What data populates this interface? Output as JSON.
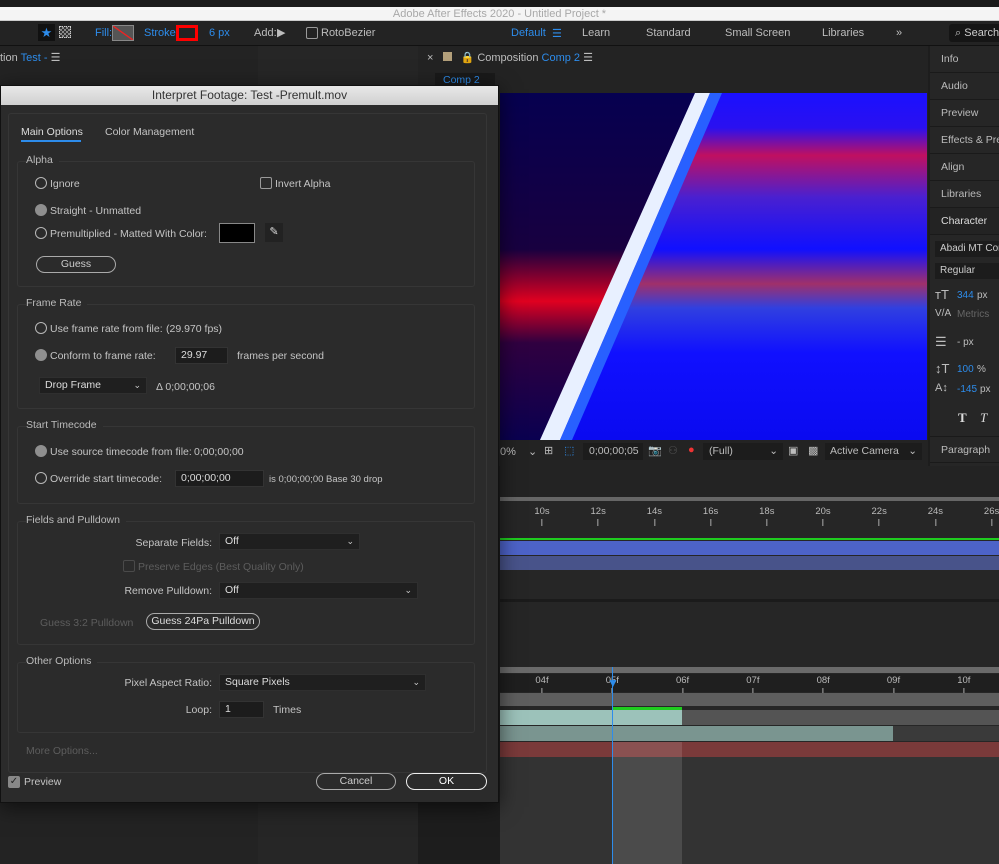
{
  "app": {
    "title": "Adobe After Effects 2020 - Untitled Project *"
  },
  "toolbar": {
    "fill_label": "Fill:",
    "stroke_label": "Stroke:",
    "stroke_width": "6 px",
    "add_label": "Add:",
    "rotobezier_label": "RotoBezier",
    "stroke_color": "#ff0000"
  },
  "workspaces": {
    "items": [
      "Default",
      "Learn",
      "Standard",
      "Small Screen",
      "Libraries"
    ],
    "active": "Default",
    "more": "»",
    "search_placeholder": "Search"
  },
  "left_panel": {
    "title_prefix": "tion",
    "title_name": "Test -"
  },
  "comp_panel": {
    "title_prefix": "Composition",
    "title_name": "Comp 2",
    "tab": "Comp 2"
  },
  "viewer_bar": {
    "zoom": "0%",
    "timecode": "0;00;00;05",
    "resolution": "(Full)",
    "camera": "Active Camera"
  },
  "right_panel": {
    "items": [
      "Info",
      "Audio",
      "Preview",
      "Effects & Presets",
      "Align",
      "Libraries"
    ],
    "character": "Character",
    "font": "Abadi MT Con",
    "style": "Regular",
    "font_size": "344",
    "font_size_unit": "px",
    "kerning": "Metrics",
    "leading": "- px",
    "vscale": "100",
    "vscale_unit": "%",
    "baseline": "-145",
    "baseline_unit": "px",
    "paragraph": "Paragraph"
  },
  "timeline": {
    "ruler_top": [
      "10s",
      "12s",
      "14s",
      "16s",
      "18s",
      "20s",
      "22s",
      "24s",
      "26s"
    ],
    "ruler_bottom": [
      "04f",
      "05f",
      "06f",
      "07f",
      "08f",
      "09f",
      "10f"
    ]
  },
  "dialog": {
    "title": "Interpret Footage: Test -Premult.mov",
    "tabs": [
      "Main Options",
      "Color Management"
    ],
    "alpha": {
      "label": "Alpha",
      "ignore": "Ignore",
      "invert": "Invert Alpha",
      "straight": "Straight - Unmatted",
      "premultiplied": "Premultiplied - Matted With Color:",
      "matte_color": "#000000",
      "guess": "Guess"
    },
    "frame_rate": {
      "label": "Frame Rate",
      "from_file": "Use frame rate from file:",
      "file_fps": "(29.970 fps)",
      "conform": "Conform to frame rate:",
      "conform_value": "29.97",
      "fps_unit": "frames per second",
      "drop": "Drop Frame",
      "delta": "Δ 0;00;00;06"
    },
    "start_timecode": {
      "label": "Start Timecode",
      "use_source": "Use source timecode from file:",
      "source_value": "0;00;00;00",
      "override": "Override start timecode:",
      "override_value": "0;00;00;00",
      "info": "is 0;00;00;00  Base 30  drop"
    },
    "fields": {
      "label": "Fields and Pulldown",
      "separate": "Separate Fields:",
      "separate_value": "Off",
      "preserve": "Preserve Edges (Best Quality Only)",
      "remove": "Remove Pulldown:",
      "remove_value": "Off",
      "guess32": "Guess 3:2 Pulldown",
      "guess24": "Guess 24Pa Pulldown"
    },
    "other": {
      "label": "Other Options",
      "par": "Pixel Aspect Ratio:",
      "par_value": "Square Pixels",
      "loop": "Loop:",
      "loop_value": "1",
      "times": "Times"
    },
    "more": "More Options...",
    "preview": "Preview",
    "cancel": "Cancel",
    "ok": "OK"
  }
}
